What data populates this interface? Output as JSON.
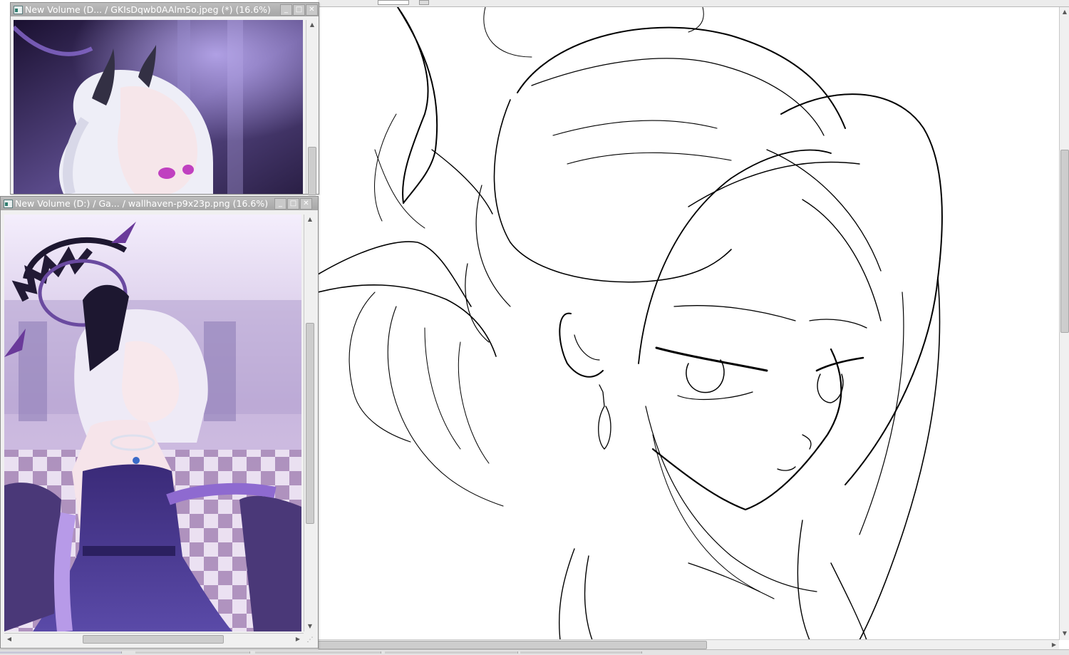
{
  "windows": [
    {
      "id": "top",
      "title": "New Volume (D... / GKIsDqwb0AAlm5o.jpeg (*) (16.6%)",
      "buttons": {
        "minimize": "_",
        "maximize": "□",
        "close": "✕"
      },
      "image_alt": "Anime character with white hair and dark horns in purple lit room"
    },
    {
      "id": "bottom",
      "title": "New Volume (D:) / Ga... / wallhaven-p9x23p.png (16.6%)",
      "buttons": {
        "minimize": "_",
        "maximize": "□",
        "close": "✕"
      },
      "image_alt": "Anime character in purple dress with halo and bat wings in checkered ballroom"
    }
  ],
  "scroll_arrows": {
    "up": "▲",
    "down": "▼",
    "left": "◀",
    "right": "▶"
  },
  "icons": {
    "resize_grip": "resize-grip-icon"
  }
}
